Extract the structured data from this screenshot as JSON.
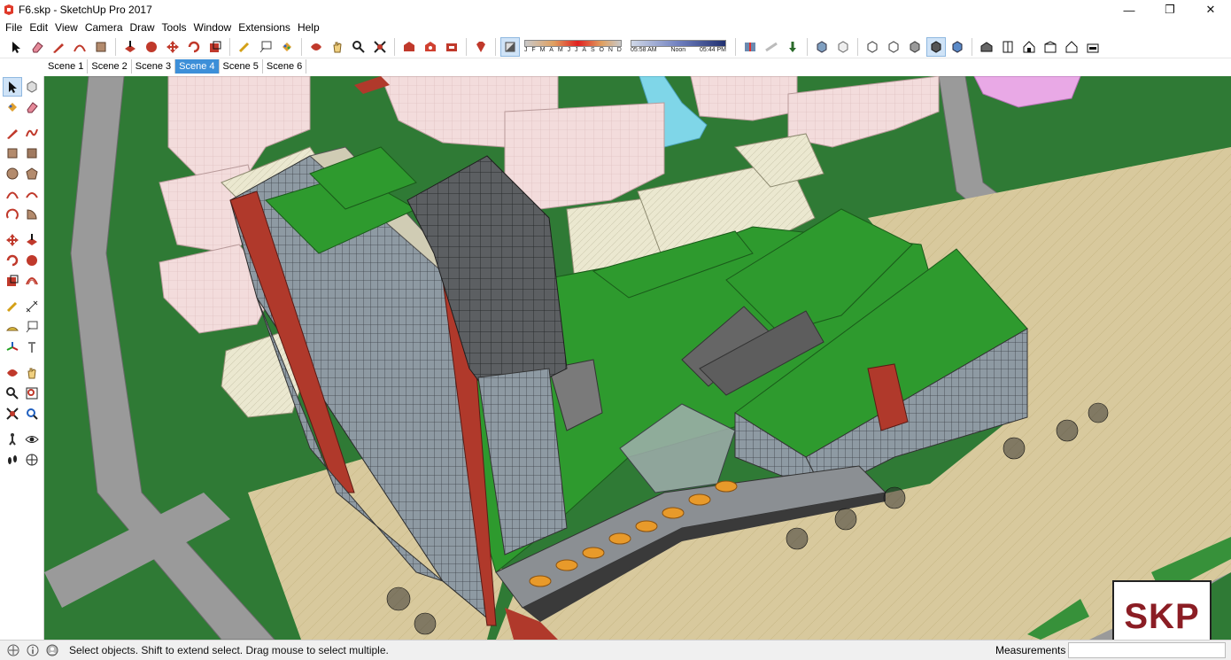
{
  "window": {
    "title": "F6.skp - SketchUp Pro 2017",
    "minimize_glyph": "—",
    "restore_glyph": "❐",
    "close_glyph": "✕"
  },
  "menu": {
    "items": [
      "File",
      "Edit",
      "View",
      "Camera",
      "Draw",
      "Tools",
      "Window",
      "Extensions",
      "Help"
    ]
  },
  "shadows": {
    "months": [
      "J",
      "F",
      "M",
      "A",
      "M",
      "J",
      "J",
      "A",
      "S",
      "O",
      "N",
      "D"
    ],
    "time_start": "05:58 AM",
    "time_mid": "Noon",
    "time_end": "05:44 PM"
  },
  "scenes": {
    "tabs": [
      "Scene 1",
      "Scene 2",
      "Scene 3",
      "Scene 4",
      "Scene 5",
      "Scene 6"
    ],
    "active": "Scene 4"
  },
  "status": {
    "message": "Select objects. Shift to extend select. Drag mouse to select multiple.",
    "measurements_label": "Measurements",
    "measurements_value": ""
  },
  "logo": {
    "text": "SKP"
  },
  "colors": {
    "accent": "#3d8fd8",
    "ground": "#2f7a35",
    "roof_green": "#2e9a2e",
    "plaza_tan": "#d9c79a",
    "road_gray": "#9a9a9a",
    "brick_red": "#b0392b",
    "logo_red": "#8b1d24"
  }
}
